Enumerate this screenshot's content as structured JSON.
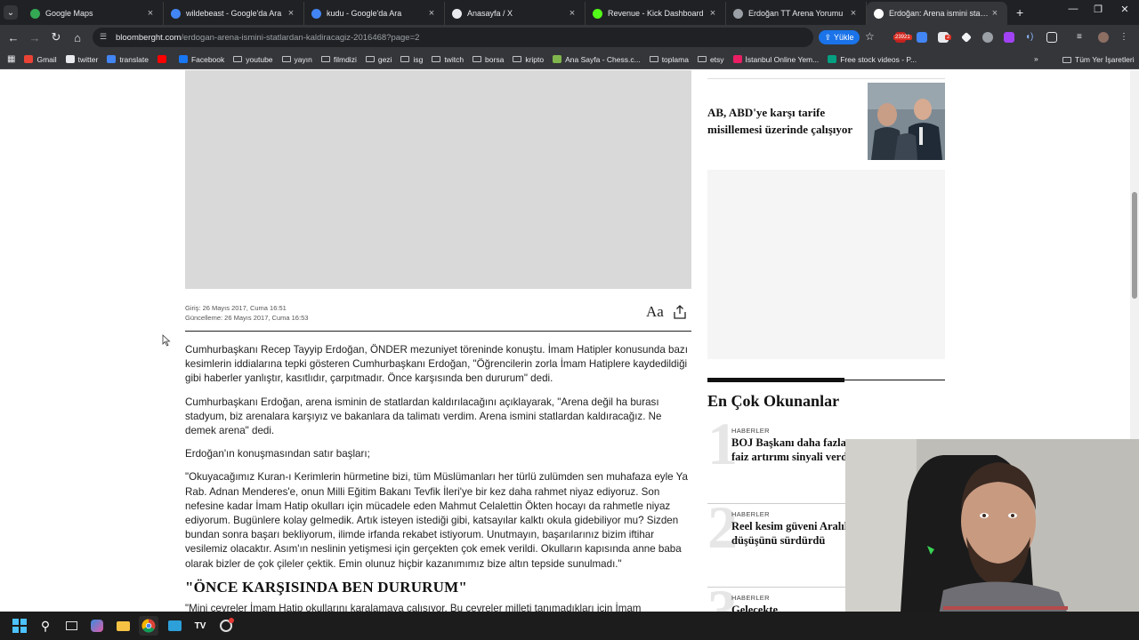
{
  "tabs": [
    {
      "title": "Google Maps",
      "favicon_color": "#34a853",
      "active": false
    },
    {
      "title": "wildebeast - Google'da Ara",
      "favicon_color": "#4285f4",
      "active": false
    },
    {
      "title": "kudu - Google'da Ara",
      "favicon_color": "#4285f4",
      "active": false
    },
    {
      "title": "Anasayfa / X",
      "favicon_color": "#e8eaed",
      "active": false
    },
    {
      "title": "Revenue - Kick Dashboard",
      "favicon_color": "#53fc18",
      "active": false
    },
    {
      "title": "Erdoğan TT Arena Yorumu",
      "favicon_color": "#9aa0a6",
      "active": false
    },
    {
      "title": "Erdoğan: Arena ismini statlardan",
      "favicon_color": "#ffffff",
      "active": true
    }
  ],
  "address": {
    "host": "bloomberght.com",
    "path": "/erdogan-arena-ismini-statlardan-kaldiracagiz-2016468?page=2",
    "upload_label": "Yükle",
    "ext_badge_1": "23921",
    "ext_badge_2": "2"
  },
  "bookmarks": [
    {
      "label": "Gmail",
      "icon": "gmail-icon"
    },
    {
      "label": "twitter",
      "icon": "x-icon"
    },
    {
      "label": "translate",
      "icon": "translate-icon"
    },
    {
      "label": "",
      "icon": "youtube-icon"
    },
    {
      "label": "Facebook",
      "icon": "facebook-icon"
    },
    {
      "label": "youtube",
      "icon": "folder-icon"
    },
    {
      "label": "yayın",
      "icon": "folder-icon"
    },
    {
      "label": "filmdizi",
      "icon": "folder-icon"
    },
    {
      "label": "gezi",
      "icon": "folder-icon"
    },
    {
      "label": "isg",
      "icon": "folder-icon"
    },
    {
      "label": "twitch",
      "icon": "folder-icon"
    },
    {
      "label": "borsa",
      "icon": "folder-icon"
    },
    {
      "label": "kripto",
      "icon": "folder-icon"
    },
    {
      "label": "Ana Sayfa - Chess.c...",
      "icon": "chess-icon"
    },
    {
      "label": "toplama",
      "icon": "folder-icon"
    },
    {
      "label": "etsy",
      "icon": "folder-icon"
    },
    {
      "label": "İstanbul Online Yem...",
      "icon": "yemek-icon"
    },
    {
      "label": "Free stock videos - P...",
      "icon": "pexels-icon"
    }
  ],
  "bookmarks_all": "Tüm Yer İşaretleri",
  "article": {
    "published": "Giriş: 26 Mayıs 2017, Cuma 16:51",
    "updated": "Güncelleme: 26 Mayıs 2017, Cuma 16:53",
    "font_button": "Aa",
    "paragraphs": [
      "Cumhurbaşkanı Recep Tayyip Erdoğan, ÖNDER mezuniyet töreninde konuştu. İmam Hatipler konusunda bazı kesimlerin iddialarına tepki gösteren Cumhurbaşkanı Erdoğan, \"Öğrencilerin zorla İmam Hatiplere kaydedildiği gibi haberler yanlıştır, kasıtlıdır, çarpıtmadır. Önce karşısında ben dururum\" dedi.",
      "Cumhurbaşkanı Erdoğan, arena isminin de statlardan kaldırılacağını açıklayarak, \"Arena değil ha burası stadyum, biz arenalara karşıyız ve bakanlara da talimatı verdim. Arena ismini statlardan kaldıracağız. Ne demek arena\" dedi.",
      "Erdoğan'ın konuşmasından satır başları;",
      "\"Okuyacağımız Kuran-ı Kerimlerin hürmetine bizi, tüm Müslümanları her türlü zulümden sen muhafaza eyle Ya Rab. Adnan Menderes'e, onun Milli Eğitim Bakanı Tevfik İleri'ye bir kez daha rahmet niyaz ediyoruz. Son nefesine kadar İmam Hatip okulları için mücadele eden Mahmut Celalettin Ökten hocayı da rahmetle niyaz ediyorum. Bugünlere kolay gelmedik. Artık isteyen istediği gibi, katsayılar kalktı okula gidebiliyor mu? Sizden bundan sonra başarı bekliyorum, ilimde irfanda rekabet istiyorum. Unutmayın, başarılarınız bizim iftihar vesilemiz olacaktır. Asım'ın neslinin yetişmesi için gerçekten çok emek verildi. Okulların kapısında anne baba olarak bizler de çok çileler çektik. Emin olunuz hiçbir kazanımımız bize altın tepside sunulmadı.\""
    ],
    "subheading": "\"ÖNCE KARŞISINDA BEN DURURUM\"",
    "cut_line": "\"Mini cevreler İmam Hatip okullarını karalamaya çalışıyor. Bu cevreler milleti tanımadıkları için İmam"
  },
  "sidebar": {
    "top_news_title": "AB, ABD'ye karşı tarife misillemesi üzerinde çalışıyor",
    "most_read_heading": "En Çok Okunanlar",
    "most_read": [
      {
        "rank": "1",
        "category": "HABERLER",
        "title": "BOJ Başkanı daha fazla faiz artırımı sinyali verdi"
      },
      {
        "rank": "2",
        "category": "HABERLER",
        "title": "Reel kesim güveni Aralık'ta düşüşünü sürdürdü"
      },
      {
        "rank": "3",
        "category": "HABERLER",
        "title": "Gelecekte"
      }
    ]
  },
  "colors": {
    "chrome_dark": "#202124",
    "chrome_mid": "#35363a",
    "accent_blue": "#1a73e8"
  }
}
